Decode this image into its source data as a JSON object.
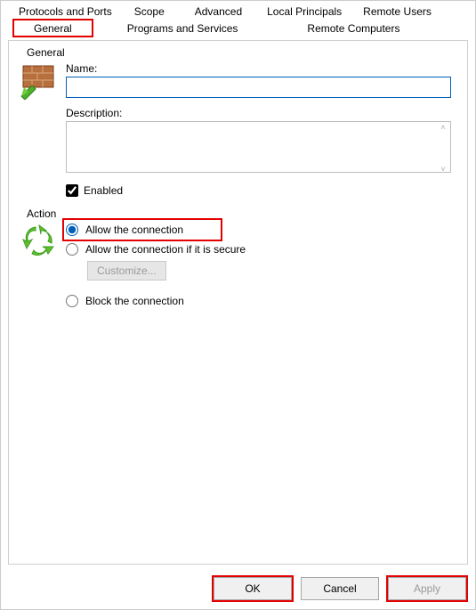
{
  "tabs": {
    "row1": {
      "protocols": "Protocols and Ports",
      "scope": "Scope",
      "advanced": "Advanced",
      "local_principals": "Local Principals",
      "remote_users": "Remote Users"
    },
    "row2": {
      "general": "General",
      "programs_services": "Programs and Services",
      "remote_computers": "Remote Computers"
    }
  },
  "general_group": {
    "legend": "General",
    "name_label": "Name:",
    "name_value": "",
    "description_label": "Description:",
    "description_value": "",
    "enabled_label": "Enabled"
  },
  "action_group": {
    "legend": "Action",
    "allow_label": "Allow the connection",
    "allow_secure_label": "Allow the connection if it is secure",
    "customize_label": "Customize...",
    "block_label": "Block the connection"
  },
  "buttons": {
    "ok": "OK",
    "cancel": "Cancel",
    "apply": "Apply"
  }
}
